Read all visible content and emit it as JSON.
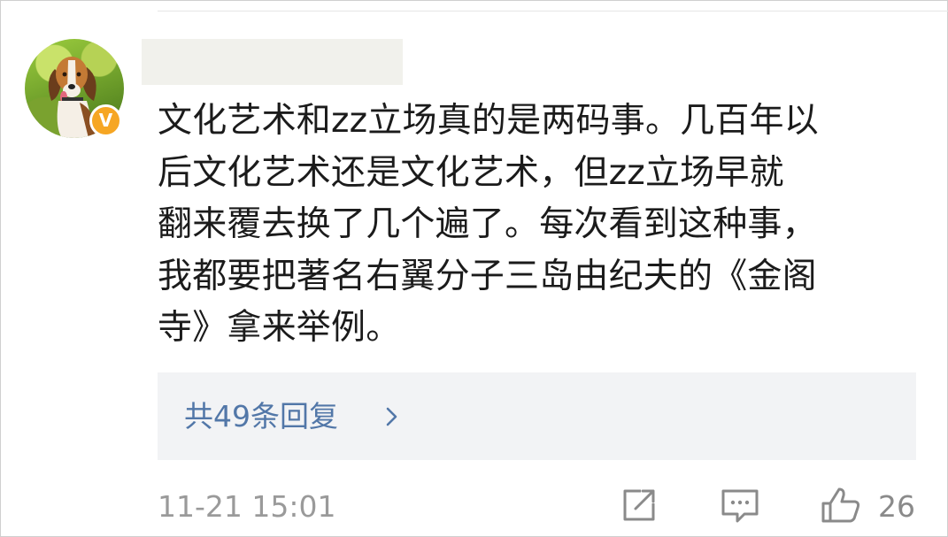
{
  "comment": {
    "lines": [
      "文化艺术和zz立场真的是两码事。几百年以",
      "后文化艺术还是文化艺术，但zz立场早就",
      "翻来覆去换了几个遍了。每次看到这种事，",
      "我都要把著名右翼分子三岛由纪夫的《金阁",
      "寺》拿来举例。"
    ]
  },
  "replies": {
    "label": "共49条回复"
  },
  "footer": {
    "timestamp": "11-21 15:01",
    "like_count": "26"
  },
  "icons": {
    "avatar_badge": "verified-v-badge",
    "reply_chevron": "chevron-right-icon",
    "share": "share-icon",
    "comment": "comment-icon",
    "like": "thumbs-up-icon"
  },
  "colors": {
    "link": "#5277a8",
    "badge": "#f6a623",
    "reply_background": "#f2f3f5"
  }
}
